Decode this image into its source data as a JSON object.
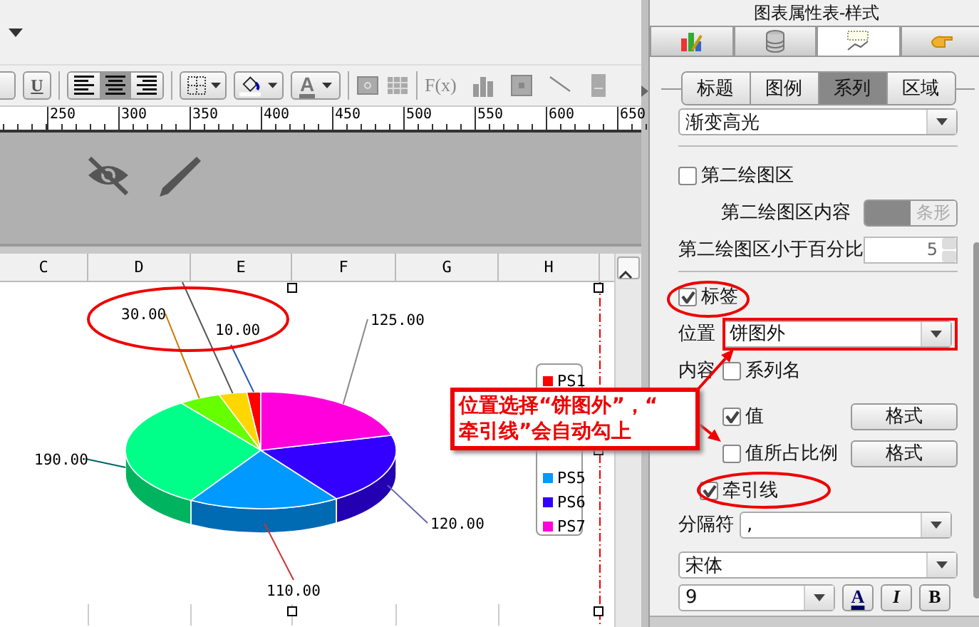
{
  "toolbar": {
    "underline_label": "U",
    "align_buttons": [
      {
        "selected": false
      },
      {
        "selected": true
      },
      {
        "selected": false
      }
    ],
    "font_color_label": "A",
    "formula_label": "F(x)"
  },
  "ruler": {
    "ticks": [
      "250",
      "300",
      "350",
      "400",
      "450",
      "500",
      "550",
      "600",
      "650"
    ]
  },
  "columns": [
    "C",
    "D",
    "E",
    "F",
    "G",
    "H"
  ],
  "pie": {
    "slices": [
      {
        "color": "#ff0000",
        "label": "10.00"
      },
      {
        "color": "#ffd700"
      },
      {
        "color": "#66ff00",
        "label": "30.00"
      },
      {
        "color": "#00ff88",
        "label": "190.00"
      },
      {
        "color": "#0099ff",
        "label": "110.00"
      },
      {
        "color": "#3300ff",
        "label": "120.00"
      },
      {
        "color": "#ff00dd",
        "label": "125.00"
      }
    ]
  },
  "legend": [
    {
      "label": "PS1",
      "color": "#ff0000"
    },
    {
      "label": "PS5",
      "color": "#0099ff"
    },
    {
      "label": "PS6",
      "color": "#3300ff"
    },
    {
      "label": "PS7",
      "color": "#ff00dd"
    }
  ],
  "panel": {
    "title": "图表属性表-样式",
    "icon_tabs": [
      {
        "kind": "chart",
        "selected": false
      },
      {
        "kind": "data",
        "selected": false
      },
      {
        "kind": "text",
        "selected": true
      },
      {
        "kind": "hand",
        "selected": false
      }
    ],
    "sub_tabs": [
      {
        "label": "标题",
        "selected": false
      },
      {
        "label": "图例",
        "selected": false
      },
      {
        "label": "系列",
        "selected": true
      },
      {
        "label": "区域",
        "selected": false
      }
    ],
    "style_select": "渐变高光",
    "second_plot": {
      "label": "第二绘图区",
      "checked": false
    },
    "second_content": {
      "label": "第二绘图区内容",
      "value": "条形",
      "disabled": true
    },
    "second_percent": {
      "label": "第二绘图区小于百分比",
      "value": "5",
      "disabled": true
    },
    "labels": {
      "label": "标签",
      "checked": true
    },
    "position": {
      "label": "位置",
      "value": "饼图外"
    },
    "content_label": "内容",
    "options": [
      {
        "label": "系列名",
        "checked": false
      },
      {
        "label": "值",
        "checked": true,
        "button": "格式"
      },
      {
        "label": "值所占比例",
        "checked": false,
        "button": "格式"
      },
      {
        "label": "牵引线",
        "checked": true
      }
    ],
    "separator": {
      "label": "分隔符",
      "value": ","
    },
    "font": "宋体",
    "size": "9",
    "font_buttons": [
      {
        "kind": "color",
        "label": "A"
      },
      {
        "kind": "italic",
        "label": "I"
      },
      {
        "kind": "bold",
        "label": "B"
      }
    ]
  },
  "callout": {
    "lines": [
      "位置选择“饼图外”，“",
      "牵引线”会自动勾上"
    ]
  }
}
